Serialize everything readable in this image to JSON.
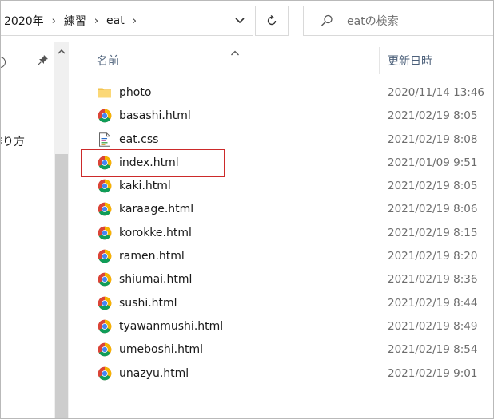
{
  "breadcrumb": {
    "items": [
      "2020年",
      "練習",
      "eat"
    ],
    "separator": "›"
  },
  "search": {
    "placeholder": "eatの検索"
  },
  "nav": {
    "label": "作り方"
  },
  "columns": {
    "name": "名前",
    "date": "更新日時"
  },
  "files": [
    {
      "name": "photo",
      "date": "2020/11/14 13:46",
      "icon": "folder-icon"
    },
    {
      "name": "basashi.html",
      "date": "2021/02/19 8:05",
      "icon": "chrome-html-icon"
    },
    {
      "name": "eat.css",
      "date": "2021/02/19 8:08",
      "icon": "css-file-icon"
    },
    {
      "name": "index.html",
      "date": "2021/01/09 9:51",
      "icon": "chrome-html-icon"
    },
    {
      "name": "kaki.html",
      "date": "2021/02/19 8:05",
      "icon": "chrome-html-icon"
    },
    {
      "name": "karaage.html",
      "date": "2021/02/19 8:06",
      "icon": "chrome-html-icon"
    },
    {
      "name": "korokke.html",
      "date": "2021/02/19 8:15",
      "icon": "chrome-html-icon"
    },
    {
      "name": "ramen.html",
      "date": "2021/02/19 8:20",
      "icon": "chrome-html-icon"
    },
    {
      "name": "shiumai.html",
      "date": "2021/02/19 8:36",
      "icon": "chrome-html-icon"
    },
    {
      "name": "sushi.html",
      "date": "2021/02/19 8:44",
      "icon": "chrome-html-icon"
    },
    {
      "name": "tyawanmushi.html",
      "date": "2021/02/19 8:49",
      "icon": "chrome-html-icon"
    },
    {
      "name": "umeboshi.html",
      "date": "2021/02/19 8:54",
      "icon": "chrome-html-icon"
    },
    {
      "name": "unazyu.html",
      "date": "2021/02/19 9:01",
      "icon": "chrome-html-icon"
    }
  ],
  "colors": {
    "highlight": "#cc2a2a",
    "header_text": "#4c607a",
    "date_text": "#6d6d6d"
  }
}
